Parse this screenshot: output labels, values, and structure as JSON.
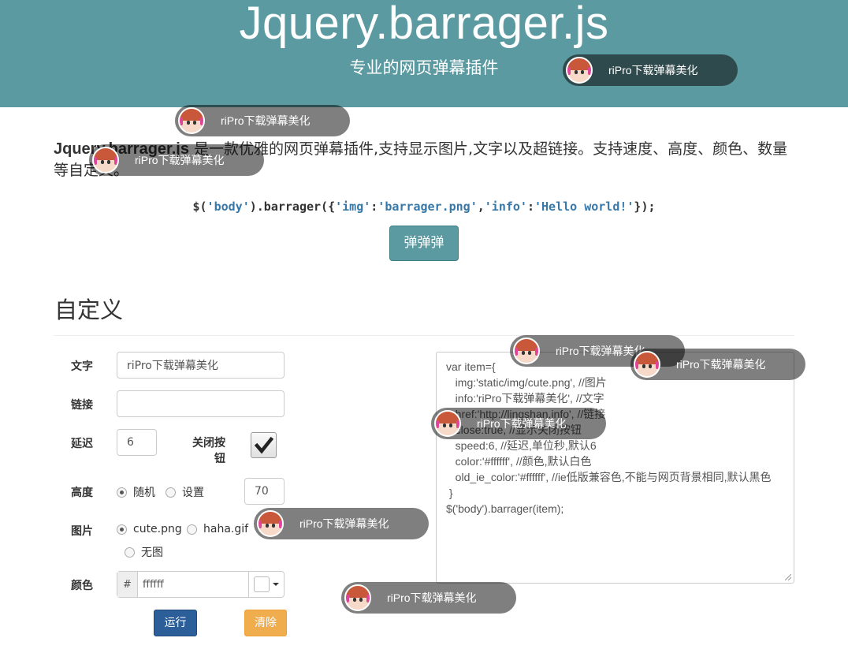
{
  "header": {
    "title": "Jquery.barrager.js",
    "subtitle": "专业的网页弹幕插件"
  },
  "intro": {
    "lib_name": "Jquery.barrager.js",
    "description": " 是一款优雅的网页弹幕插件,支持显示图片,文字以及超链接。支持速度、高度、颜色、数量等自定义。"
  },
  "code_example": {
    "prefix": "$(",
    "selector": "'body'",
    "middle": ").barrager({",
    "k1": "'img'",
    "colon1": ":",
    "v1": "'barrager.png'",
    "comma": ",",
    "k2": "'info'",
    "colon2": ":",
    "v2": "'Hello world!'",
    "suffix": "});"
  },
  "fire_button": "弹弹弹",
  "section_title": "自定义",
  "form": {
    "text_label": "文字",
    "text_value": "riPro下载弹幕美化",
    "link_label": "链接",
    "link_value": "",
    "delay_label": "延迟",
    "delay_value": "6",
    "close_label": "关闭按钮",
    "close_checked": true,
    "height_label": "高度",
    "height_opt_random": "随机",
    "height_opt_set": "设置",
    "height_value": "70",
    "image_label": "图片",
    "image_opt_cute": "cute.png",
    "image_opt_haha": "haha.gif",
    "image_opt_none": "无图",
    "color_label": "颜色",
    "color_prefix": "#",
    "color_value": "ffffff",
    "color_swatch": "#ffffff",
    "run_button": "运行",
    "clear_button": "清除"
  },
  "code_area": "var item={\n   img:'static/img/cute.png', //图片\n   info:'riPro下载弹幕美化', //文字\n   href:'http://lingshan.info', //链接\n   close:true, //显示关闭按钮\n   speed:6, //延迟,单位秒,默认6\n   color:'#ffffff', //颜色,默认白色\n   old_ie_color:'#ffffff', //ie低版兼容色,不能与网页背景相同,默认黑色\n }\n$('body').barrager(item);",
  "barrages": [
    {
      "text": "riPro下载弹幕美化"
    },
    {
      "text": "riPro下载弹幕美化"
    },
    {
      "text": "riPro下载弹幕美化"
    },
    {
      "text": "riPro下载弹幕美化"
    },
    {
      "text": "riPro下载弹幕美化"
    },
    {
      "text": "riPro下载弹幕美化"
    },
    {
      "text": "riPro下载弹幕美化"
    },
    {
      "text": "riPro下载弹幕美化"
    }
  ],
  "colors": {
    "header_bg": "#5a9aa0",
    "run_button": "#2c5f99",
    "clear_button": "#f0ad4e"
  }
}
